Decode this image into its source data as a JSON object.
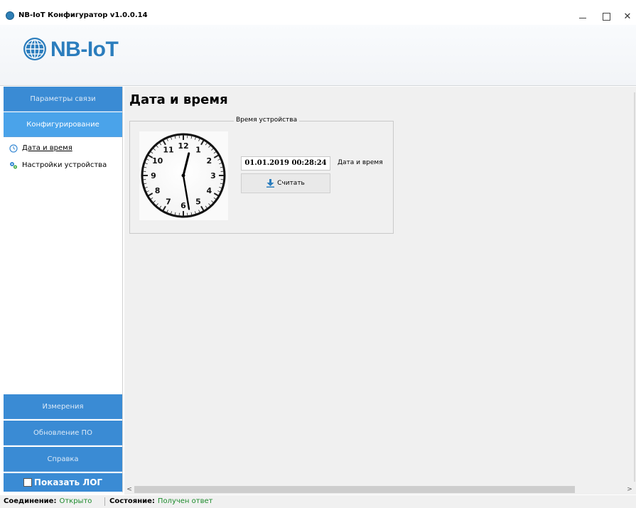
{
  "window": {
    "title": "NB-IoT Конфигуратор v1.0.0.14",
    "minimize_glyph": "—",
    "maximize_glyph": "☐",
    "close_glyph": "✕"
  },
  "logo": {
    "text": "NB-IoT",
    "color": "#2b7dbd"
  },
  "sidebar": {
    "top_buttons": [
      {
        "label": "Параметры связи",
        "active": false
      },
      {
        "label": "Конфигурирование",
        "active": true
      }
    ],
    "tree": [
      {
        "label": "Дата и время",
        "icon": "clock-icon",
        "selected": true
      },
      {
        "label": "Настройки устройства",
        "icon": "gears-icon",
        "selected": false
      }
    ],
    "bottom_buttons": [
      {
        "label": "Измерения"
      },
      {
        "label": "Обновление ПО"
      },
      {
        "label": "Справка"
      }
    ],
    "show_log": {
      "label": "Показать ЛОГ",
      "checked": false
    }
  },
  "content": {
    "title": "Дата и время",
    "group": {
      "legend": "Время устройства",
      "datetime_value": "01.01.2019 00:28:24",
      "datetime_label": "Дата и время",
      "read_button": "Считать"
    },
    "clock": {
      "hour": 0,
      "minute": 28,
      "second": 24,
      "numerals": [
        "12",
        "1",
        "2",
        "3",
        "4",
        "5",
        "6",
        "7",
        "8",
        "9",
        "10",
        "11"
      ]
    }
  },
  "scrollbar": {
    "left_arrow": "<",
    "right_arrow": ">"
  },
  "status": {
    "connection_key": "Соединение:",
    "connection_value": "Открыто",
    "state_key": "Состояние:",
    "state_value": "Получен ответ",
    "ok_color": "#1c8a2b"
  },
  "colors": {
    "nav_blue": "#3a8bd4",
    "nav_active": "#4aa3ea"
  }
}
